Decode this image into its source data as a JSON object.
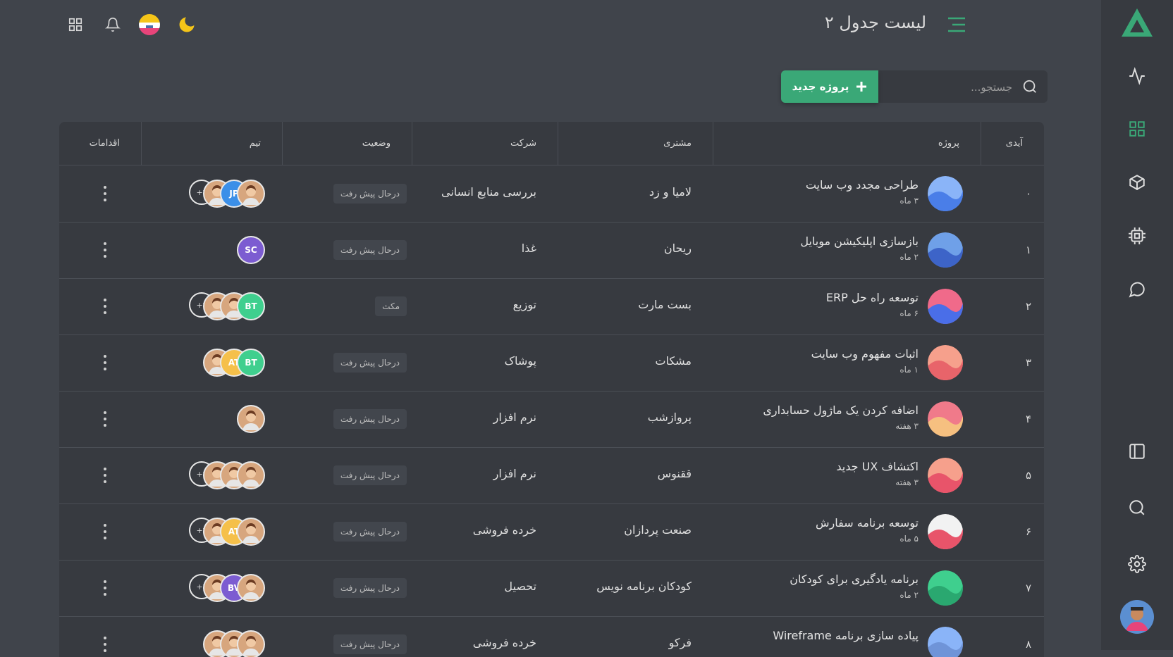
{
  "page": {
    "title": "لیست جدول ۲"
  },
  "search": {
    "placeholder": "جستجو..."
  },
  "new_project_label": "پروژه جدید",
  "columns": [
    "آیدی",
    "پروژه",
    "مشتری",
    "شرکت",
    "وضعیت",
    "تیم",
    "اقدامات"
  ],
  "rows": [
    {
      "id": "۰",
      "project": "طراحی مجدد وب سایت",
      "duration": "۳ ماه",
      "client": "لامیا و زد",
      "company": "بررسی منابع انسانی",
      "status": "درحال پیش رفت",
      "team": [
        "img",
        "JP",
        "img"
      ],
      "more": "+۲"
    },
    {
      "id": "۱",
      "project": "بازسازی اپلیکیشن موبایل",
      "duration": "۲ ماه",
      "client": "ریحان",
      "company": "غذا",
      "status": "درحال پیش رفت",
      "team": [
        "SC"
      ],
      "more": ""
    },
    {
      "id": "۲",
      "project": "توسعه راه حل ERP",
      "duration": "۶ ماه",
      "client": "بست مارت",
      "company": "توزیع",
      "status": "مکث",
      "team": [
        "BT",
        "img",
        "img"
      ],
      "more": "+۳"
    },
    {
      "id": "۳",
      "project": "اثبات مفهوم وب سایت",
      "duration": "۱ ماه",
      "client": "مشکات",
      "company": "پوشاک",
      "status": "درحال پیش رفت",
      "team": [
        "BT",
        "AT",
        "img"
      ],
      "more": ""
    },
    {
      "id": "۴",
      "project": "اضافه کردن یک ماژول حسابداری",
      "duration": "۳ هفته",
      "client": "پروازشب",
      "company": "نرم افزار",
      "status": "درحال پیش رفت",
      "team": [
        "img"
      ],
      "more": ""
    },
    {
      "id": "۵",
      "project": "اکتشاف UX جدید",
      "duration": "۳ هفته",
      "client": "ققنوس",
      "company": "نرم افزار",
      "status": "درحال پیش رفت",
      "team": [
        "img",
        "img",
        "img"
      ],
      "more": "+۴"
    },
    {
      "id": "۶",
      "project": "توسعه برنامه سفارش",
      "duration": "۵ ماه",
      "client": "صنعت پردازان",
      "company": "خرده فروشی",
      "status": "درحال پیش رفت",
      "team": [
        "img",
        "AT",
        "img"
      ],
      "more": "+۳"
    },
    {
      "id": "۷",
      "project": "برنامه یادگیری برای کودکان",
      "duration": "۲ ماه",
      "client": "کودکان برنامه نویس",
      "company": "تحصیل",
      "status": "درحال پیش رفت",
      "team": [
        "img",
        "BV",
        "img"
      ],
      "more": "+۲"
    },
    {
      "id": "۸",
      "project": "پیاده سازی برنامه Wireframe",
      "duration": "",
      "client": "فرکو",
      "company": "خرده فروشی",
      "status": "درحال پیش رفت",
      "team": [
        "img",
        "img",
        "img"
      ],
      "more": ""
    }
  ],
  "colors": {
    "accent": "#3aa877",
    "bg": "#40444b",
    "panel": "#373a40"
  }
}
